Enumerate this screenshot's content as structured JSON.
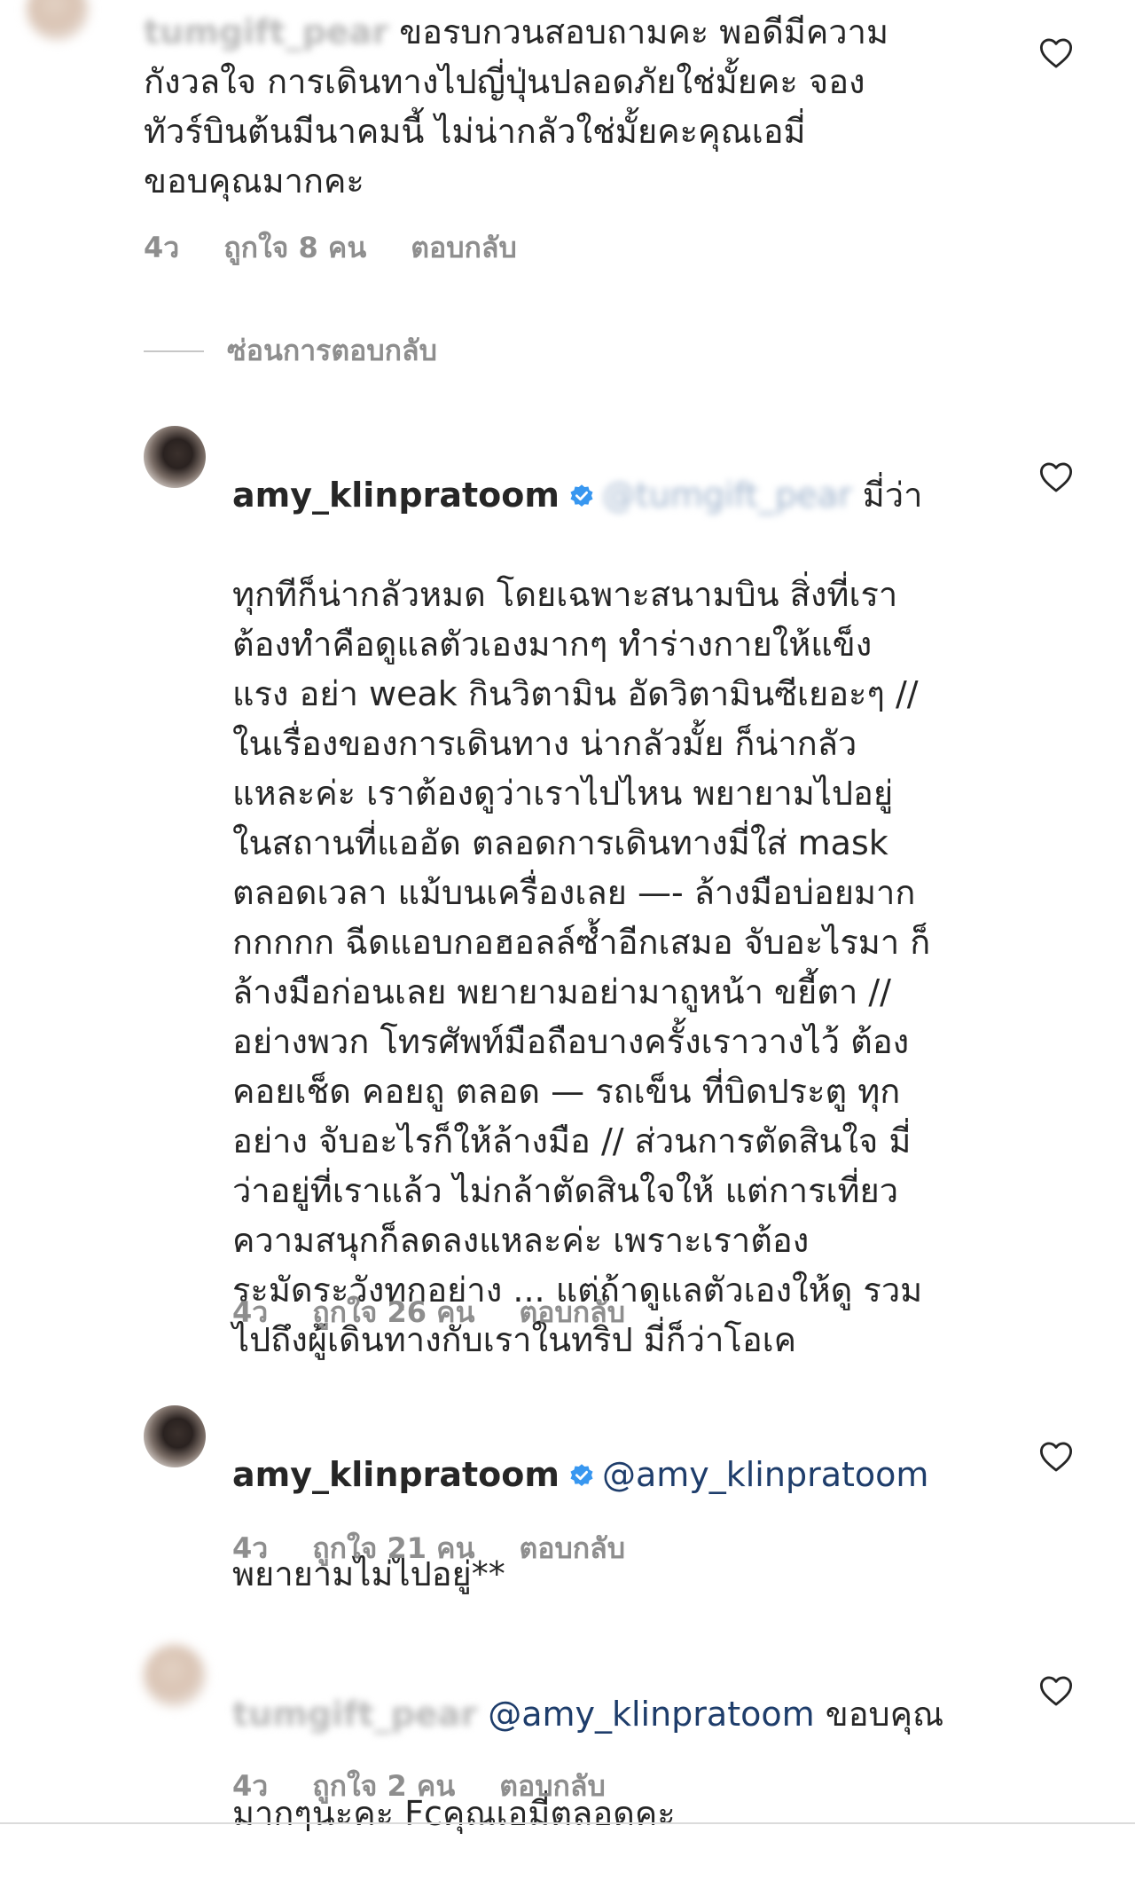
{
  "comments": [
    {
      "username": "tumgift_pear",
      "text": "ขอรบกวนสอบถามคะ พอดีมีความ\nกังวลใจ การเดินทางไปญี่ปุ่นปลอดภัยใช่มั้ยคะ จอง\nทัวร์บินต้นมีนาคมนี้ ไม่น่ากลัวใช่มั้ยคะคุณเอมี่\nขอบคุณมากคะ",
      "time": "4ว",
      "likes": "ถูกใจ 8 คน",
      "reply": "ตอบกลับ"
    },
    {
      "username": "amy_klinpratoom",
      "mention": "@tumgift_pear",
      "first_line": " มี่ว่า",
      "text": "ทุกทีก็น่ากลัวหมด โดยเฉพาะสนามบิน สิ่งที่เรา\nต้องทำคือดูแลตัวเองมากๆ ทำร่างกายให้แข็ง\nแรง อย่า weak กินวิตามิน อัดวิตามินซีเยอะๆ //\nในเรื่องของการเดินทาง น่ากลัวมั้ย ก็น่ากลัว\nแหละค่ะ เราต้องดูว่าเราไปไหน พยายามไปอยู่\nในสถานที่แออัด ตลอดการเดินทางมี่ใส่ mask\nตลอดเวลา แม้บนเครื่องเลย —- ล้างมือบ่อยมาก\nกกกกก ฉีดแอบกอฮอลล์ซ้ำอีกเสมอ จับอะไรมา ก็\nล้างมือก่อนเลย พยายามอย่ามาถูหน้า ขยี้ตา //\nอย่างพวก โทรศัพท์มือถือบางครั้งเราวางไว้ ต้อง\nคอยเช็ด คอยถู ตลอด — รถเข็น ที่บิดประตู ทุก\nอย่าง จับอะไรก็ให้ล้างมือ // ส่วนการตัดสินใจ มี่\nว่าอยู่ที่เราแล้ว ไม่กล้าตัดสินใจให้ แต่การเที่ยว\nความสนุกก็ลดลงแหละค่ะ เพราะเราต้อง\nระมัดระวังทุกอย่าง ... แต่ถ้าดูแลตัวเองให้ดู รวม\nไปถึงผู้เดินทางกับเราในทริป มี่ก็ว่าโอเค",
      "time": "4ว",
      "likes": "ถูกใจ 26 คน",
      "reply": "ตอบกลับ"
    },
    {
      "username": "amy_klinpratoom",
      "mention": "@amy_klinpratoom",
      "text": "พยายามไม่ไปอยู่**",
      "time": "4ว",
      "likes": "ถูกใจ 21 คน",
      "reply": "ตอบกลับ"
    },
    {
      "username": "tumgift_pear",
      "mention": "@amy_klinpratoom",
      "first_line": " ขอบคุณ",
      "text": "มากๆนะคะ Fcคุณเอมี่ตลอดคะ",
      "time": "4ว",
      "likes": "ถูกใจ 2 คน",
      "reply": "ตอบกลับ"
    }
  ],
  "hide_replies": "ซ่อนการตอบกลับ",
  "colors": {
    "text": "#262626",
    "secondary": "#8e8e8e",
    "mention": "#1e3d6b",
    "verified": "#3897f0"
  }
}
